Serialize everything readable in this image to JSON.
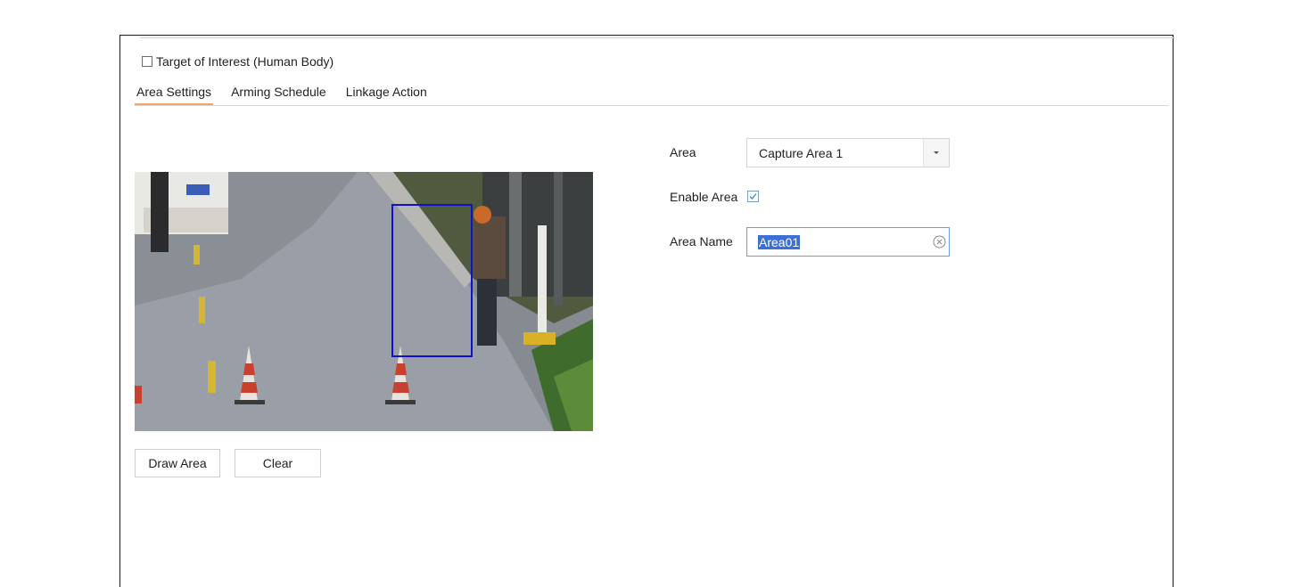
{
  "detection": {
    "target_label": "Target of Interest (Human Body)",
    "target_checked": false
  },
  "tabs": [
    {
      "label": "Area Settings",
      "active": true
    },
    {
      "label": "Arming Schedule",
      "active": false
    },
    {
      "label": "Linkage Action",
      "active": false
    }
  ],
  "buttons": {
    "draw_area": "Draw Area",
    "clear": "Clear"
  },
  "form": {
    "area_label": "Area",
    "area_value": "Capture Area 1",
    "enable_label": "Enable Area",
    "enable_checked": true,
    "name_label": "Area Name",
    "name_value": "Area01"
  },
  "colors": {
    "tab_active_underline": "#f3a56b",
    "detection_box": "#1010d0",
    "input_focus_border": "#6d9de0",
    "selection_highlight": "#3b6fd6"
  },
  "icons": {
    "select_arrow": "chevron-down-icon",
    "input_clear": "clear-circle-icon",
    "checkbox": "checkmark-icon"
  }
}
